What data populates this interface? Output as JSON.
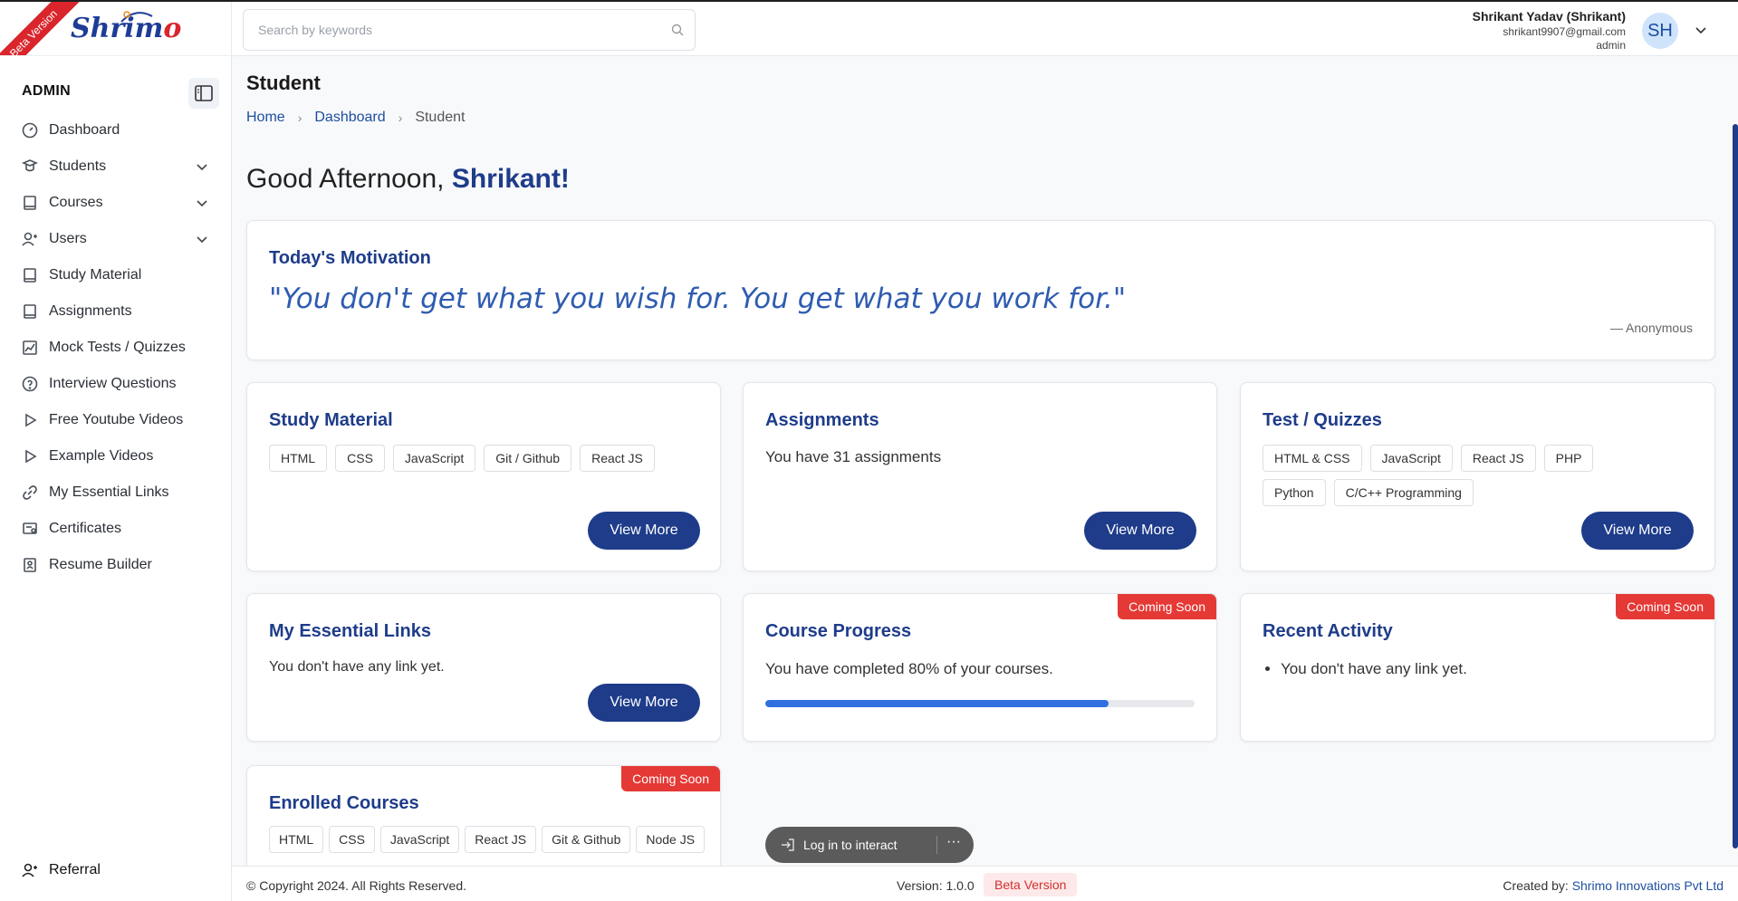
{
  "brand": {
    "name_main": "Shrim",
    "name_accent": "o",
    "ribbon": "Beta Version"
  },
  "sidebar": {
    "section_label": "ADMIN",
    "items": [
      {
        "label": "Dashboard",
        "icon": "dashboard-icon"
      },
      {
        "label": "Students",
        "icon": "students-icon",
        "expandable": true
      },
      {
        "label": "Courses",
        "icon": "book-icon",
        "expandable": true
      },
      {
        "label": "Users",
        "icon": "users-icon",
        "expandable": true
      },
      {
        "label": "Study Material",
        "icon": "book-icon"
      },
      {
        "label": "Assignments",
        "icon": "book-icon"
      },
      {
        "label": "Mock Tests / Quizzes",
        "icon": "chart-icon"
      },
      {
        "label": "Interview Questions",
        "icon": "question-icon"
      },
      {
        "label": "Free Youtube Videos",
        "icon": "play-icon"
      },
      {
        "label": "Example Videos",
        "icon": "play-icon"
      },
      {
        "label": "My Essential Links",
        "icon": "link-icon"
      },
      {
        "label": "Certificates",
        "icon": "certificate-icon"
      },
      {
        "label": "Resume Builder",
        "icon": "resume-icon"
      }
    ],
    "referral": "Referral"
  },
  "header": {
    "search_placeholder": "Search by keywords",
    "user_name": "Shrikant Yadav (Shrikant)",
    "user_email": "shrikant9907@gmail.com",
    "user_role": "admin",
    "avatar_initials": "SH"
  },
  "page": {
    "title": "Student",
    "breadcrumb": [
      "Home",
      "Dashboard",
      "Student"
    ],
    "greeting_prefix": "Good Afternoon, ",
    "greeting_name": "Shrikant!"
  },
  "motivation": {
    "title": "Today's Motivation",
    "quote": "\"You don't get what you wish for. You get what you work for.\"",
    "author": "— Anonymous"
  },
  "cards": {
    "study_material": {
      "title": "Study Material",
      "tags": [
        "HTML",
        "CSS",
        "JavaScript",
        "Git / Github",
        "React JS"
      ],
      "button": "View More"
    },
    "assignments": {
      "title": "Assignments",
      "text": "You have 31 assignments",
      "button": "View More"
    },
    "tests": {
      "title": "Test / Quizzes",
      "tags": [
        "HTML & CSS",
        "JavaScript",
        "React JS",
        "PHP",
        "Python",
        "C/C++ Programming"
      ],
      "button": "View More"
    },
    "links": {
      "title": "My Essential Links",
      "text": "You don't have any link yet.",
      "button": "View More"
    },
    "progress": {
      "title": "Course Progress",
      "text": "You have completed 80% of your courses.",
      "badge": "Coming Soon",
      "percent": 80
    },
    "activity": {
      "title": "Recent Activity",
      "items": [
        "You don't have any link yet."
      ],
      "badge": "Coming Soon"
    },
    "enrolled": {
      "title": "Enrolled Courses",
      "tags": [
        "HTML",
        "CSS",
        "JavaScript",
        "React JS",
        "Git & Github",
        "Node JS"
      ],
      "badge": "Coming Soon"
    }
  },
  "footer": {
    "copyright": "© Copyright 2024. All Rights Reserved.",
    "version": "Version: 1.0.0",
    "beta": "Beta Version",
    "created_by": "Created by: ",
    "company": "Shrimo Innovations Pvt Ltd"
  },
  "overlay": {
    "login_label": "Log in to interact",
    "more": "···"
  },
  "colors": {
    "primary": "#1e3c8a",
    "accent_red": "#e53935",
    "progress": "#2f6fde"
  }
}
